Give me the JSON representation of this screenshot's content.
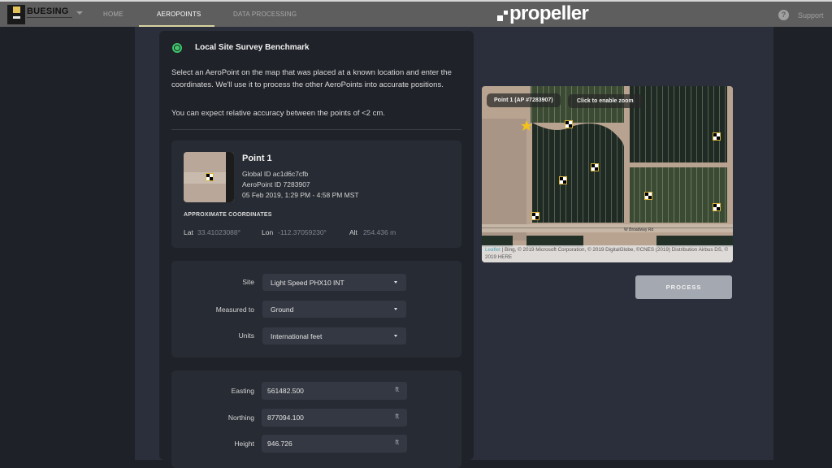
{
  "nav": {
    "logo_text": "BUESING",
    "items": [
      {
        "label": "HOME",
        "active": false
      },
      {
        "label": "AEROPOINTS",
        "active": true
      },
      {
        "label": "DATA PROCESSING",
        "active": false
      }
    ],
    "brand": "propeller",
    "help_glyph": "?",
    "support_label": "Support"
  },
  "benchmark": {
    "title": "Local Site Survey Benchmark",
    "selected": true,
    "description": "Select an AeroPoint on the map that was placed at a known location and enter the coordinates. We'll use it to process the other AeroPoints into accurate positions.",
    "accuracy_note": "You can expect relative accuracy between the points of <2 cm."
  },
  "point": {
    "title": "Point 1",
    "global_id": "Global ID ac1d6c7cfb",
    "aeropoint_id": "AeroPoint ID 7283907",
    "time_range": "05 Feb 2019, 1:29 PM - 4:58 PM MST",
    "approx_heading": "APPROXIMATE COORDINATES",
    "lat_label": "Lat",
    "lat": "33.41023088°",
    "lon_label": "Lon",
    "lon": "-112.37059230°",
    "alt_label": "Alt",
    "alt": "254.436 m"
  },
  "settings": {
    "site_label": "Site",
    "site_value": "Light Speed PHX10 INT",
    "measured_label": "Measured to",
    "measured_value": "Ground",
    "units_label": "Units",
    "units_value": "International feet"
  },
  "coords": {
    "easting_label": "Easting",
    "easting": "561482.500",
    "northing_label": "Northing",
    "northing": "877094.100",
    "height_label": "Height",
    "height": "946.726",
    "unit": "ft"
  },
  "map": {
    "point_tooltip": "Point 1 (AP #7283907)",
    "zoom_hint": "Click to enable zoom",
    "road_label": "W Broadway Rd",
    "attribution_link": "Leaflet",
    "attribution": " | Bing, © 2019 Microsoft Corporation, © 2019 DigitalGlobe, ©CNES (2019) Distribution Airbus DS, © 2019 HERE"
  },
  "process_label": "PROCESS",
  "colors": {
    "accent_green": "#3ec76a",
    "nav_underline": "#d9d2a2",
    "marker_border": "#d8b43a",
    "star": "#f3c21a"
  }
}
